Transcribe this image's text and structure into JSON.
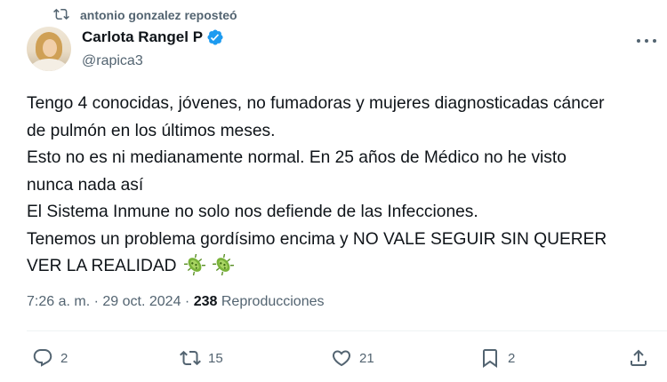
{
  "repost": {
    "icon": "repost-icon",
    "label": "antonio gonzalez reposteó"
  },
  "author": {
    "name": "Carlota Rangel P",
    "handle": "@rapica3",
    "verified": true,
    "verified_color": "#1d9bf0"
  },
  "tweet": {
    "lines": [
      "Tengo 4 conocidas, jóvenes, no fumadoras y mujeres diagnosticadas cáncer",
      "de pulmón en los últimos meses.",
      "Esto no es ni medianamente normal. En 25 años de Médico no he visto",
      "nunca nada así",
      "El Sistema Inmune no solo nos defiende de las Infecciones.",
      "Tenemos un problema gordísimo encima y NO VALE SEGUIR SIN QUERER",
      "VER LA REALIDAD"
    ],
    "emojis": [
      "microbe-emoji",
      "microbe-emoji"
    ]
  },
  "meta": {
    "time": "7:26 a. m.",
    "separator": "·",
    "date": "29 oct. 2024",
    "views_count": "238",
    "views_label": "Reproducciones"
  },
  "actions": {
    "replies": "2",
    "reposts": "15",
    "likes": "21",
    "bookmarks": "2"
  },
  "colors": {
    "text": "#0f1419",
    "secondary": "#536471",
    "divider": "#eff3f4"
  }
}
